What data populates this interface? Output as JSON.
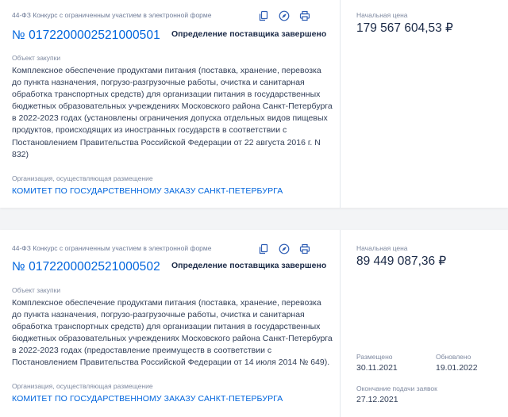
{
  "cards": [
    {
      "law_type": "44-ФЗ Конкурс с ограниченным участием в электронной форме",
      "number": "№ 0172200002521000501",
      "status": "Определение поставщика завершено",
      "object_label": "Объект закупки",
      "object_text": "Комплексное обеспечение продуктами питания (поставка, хранение, перевозка до пункта назначения, погрузо-разгрузочные работы, очистка и санитарная обработка транспортных средств) для организации питания в государственных бюджетных образовательных учреждениях Московского района Санкт-Петербурга в 2022-2023 годах (установлены ограничения допуска отдельных видов пищевых продуктов, происходящих из иностранных государств в соответствии с Постановлением Правительства Российской Федерации от 22 августа 2016 г. N 832)",
      "org_label": "Организация, осуществляющая размещение",
      "org_name": "КОМИТЕТ ПО ГОСУДАРСТВЕННОМУ ЗАКАЗУ САНКТ-ПЕТЕРБУРГА",
      "price_label": "Начальная цена",
      "price": "179 567 604,53 ₽"
    },
    {
      "law_type": "44-ФЗ Конкурс с ограниченным участием в электронной форме",
      "number": "№ 0172200002521000502",
      "status": "Определение поставщика завершено",
      "object_label": "Объект закупки",
      "object_text": "Комплексное обеспечение продуктами питания (поставка, хранение, перевозка до пункта назначения, погрузо-разгрузочные работы, очистка и санитарная обработка транспортных средств) для организации питания в государственных бюджетных образовательных учреждениях Московского района Санкт-Петербурга в 2022-2023 годах (предоставление преимуществ в соответствии с Постановлением Правительства Российской Федерации от 14 июля 2014 № 649).",
      "org_label": "Организация, осуществляющая размещение",
      "org_name": "КОМИТЕТ ПО ГОСУДАРСТВЕННОМУ ЗАКАЗУ САНКТ-ПЕТЕРБУРГА",
      "price_label": "Начальная цена",
      "price": "89 449 087,36 ₽",
      "placed_label": "Размещено",
      "placed_date": "30.11.2021",
      "updated_label": "Обновлено",
      "updated_date": "19.01.2022",
      "deadline_label": "Окончание подачи заявок",
      "deadline_date": "27.12.2021"
    }
  ],
  "icons": [
    "copy-icon",
    "compass-icon",
    "print-icon"
  ],
  "colors": {
    "link": "#0065dd",
    "text": "#334059",
    "muted": "#7f8aa1",
    "bg": "#f3f4f6"
  }
}
